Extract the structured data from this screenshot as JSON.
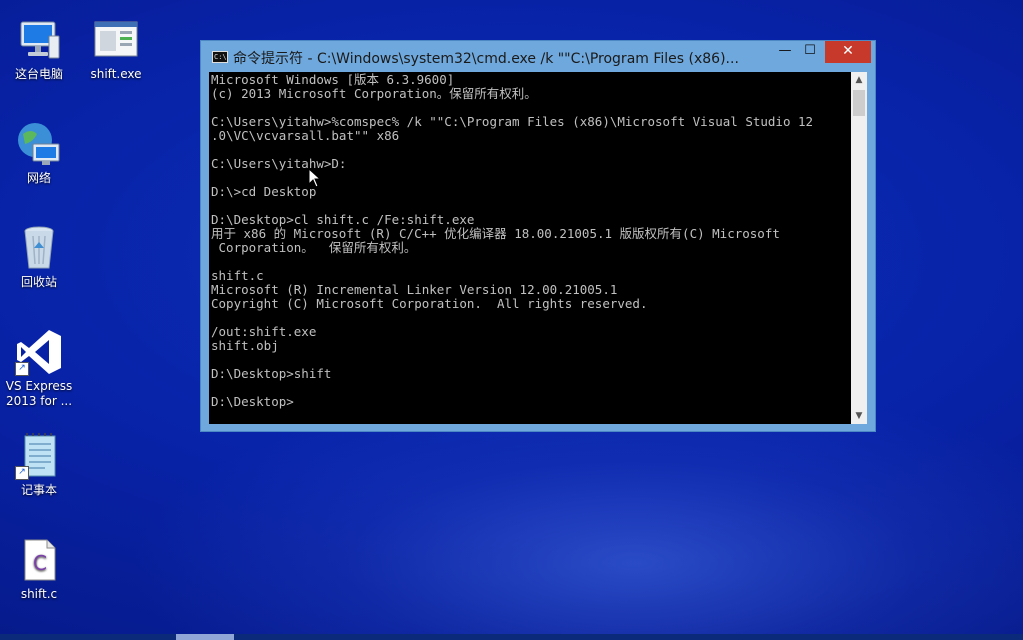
{
  "desktop": {
    "icons": [
      {
        "label": "这台电脑",
        "icon": "this-pc-icon"
      },
      {
        "label": "shift.exe",
        "icon": "exe-file-icon"
      },
      {
        "label": "网络",
        "icon": "network-icon"
      },
      {
        "label": "回收站",
        "icon": "recycle-bin-icon"
      },
      {
        "label": "VS Express\n2013 for ...",
        "icon": "visual-studio-icon"
      },
      {
        "label": "记事本",
        "icon": "notepad-icon"
      },
      {
        "label": "shift.c",
        "icon": "c-source-file-icon"
      }
    ]
  },
  "cmd_window": {
    "title": "命令提示符 - C:\\Windows\\system32\\cmd.exe  /k \"\"C:\\Program Files (x86)...",
    "title_icon_text": "C:\\",
    "minimize_glyph": "—",
    "maximize_glyph": "☐",
    "close_glyph": "✕",
    "console_text": "Microsoft Windows [版本 6.3.9600]\n(c) 2013 Microsoft Corporation。保留所有权利。\n\nC:\\Users\\yitahw>%comspec% /k \"\"C:\\Program Files (x86)\\Microsoft Visual Studio 12\n.0\\VC\\vcvarsall.bat\"\" x86\n\nC:\\Users\\yitahw>D:\n\nD:\\>cd Desktop\n\nD:\\Desktop>cl shift.c /Fe:shift.exe\n用于 x86 的 Microsoft (R) C/C++ 优化编译器 18.00.21005.1 版版权所有(C) Microsoft\n Corporation。  保留所有权利。\n\nshift.c\nMicrosoft (R) Incremental Linker Version 12.00.21005.1\nCopyright (C) Microsoft Corporation.  All rights reserved.\n\n/out:shift.exe\nshift.obj\n\nD:\\Desktop>shift\n\nD:\\Desktop>",
    "scroll_up_glyph": "▲",
    "scroll_down_glyph": "▼"
  },
  "colors": {
    "console_bg": "#000000",
    "console_fg": "#c0c0c0",
    "window_frame": "#6fa8dc",
    "close_button": "#c7392a",
    "desktop_bg": "#0822a6"
  }
}
